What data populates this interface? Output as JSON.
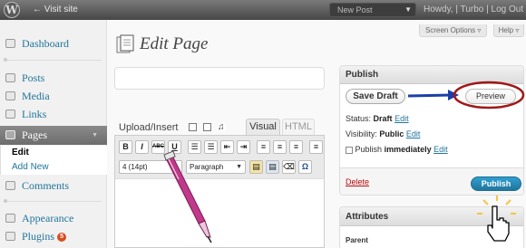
{
  "adminbar": {
    "visit_site": "← Visit site",
    "new_post": "New Post",
    "howdy": "Howdy, |",
    "user": "Turbo",
    "logout": "| Log Out"
  },
  "sidebar": {
    "items": [
      {
        "label": "Dashboard",
        "icon": "dashboard-icon"
      },
      {
        "label": "Posts",
        "icon": "pin-icon"
      },
      {
        "label": "Media",
        "icon": "media-icon"
      },
      {
        "label": "Links",
        "icon": "link-icon"
      },
      {
        "label": "Pages",
        "icon": "pages-icon"
      },
      {
        "label": "Comments",
        "icon": "comment-icon"
      },
      {
        "label": "Appearance",
        "icon": "appearance-icon"
      },
      {
        "label": "Plugins",
        "icon": "plugin-icon"
      }
    ],
    "submenu": [
      "Edit",
      "Add New"
    ],
    "plugins_badge": "5"
  },
  "header": {
    "title": "Edit Page",
    "screen_options": "Screen Options ▿",
    "help": "Help ▿"
  },
  "editor": {
    "upload_insert": "Upload/Insert",
    "tab_visual": "Visual",
    "tab_html": "HTML",
    "font_size": "4 (14pt)",
    "format": "Paragraph",
    "btn_bold": "B",
    "btn_italic": "I",
    "btn_strike": "ABC",
    "btn_underline": "U",
    "btn_omega": "Ω"
  },
  "publish": {
    "heading": "Publish",
    "save_draft": "Save Draft",
    "preview": "Preview",
    "status_label": "Status:",
    "status_value": "Draft",
    "visibility_label": "Visibility:",
    "visibility_value": "Public",
    "publish_label": "Publish",
    "publish_value": "immediately",
    "edit": "Edit",
    "delete": "Delete",
    "publish_button": "Publish"
  },
  "attributes": {
    "heading": "Attributes",
    "parent_label": "Parent"
  },
  "colors": {
    "link": "#21759b",
    "publish_button": "#21759b",
    "delete": "#bc0b0b",
    "annotation_arrow": "#1a3fa8",
    "annotation_circle": "#a01818",
    "pen": "#c0398a"
  }
}
